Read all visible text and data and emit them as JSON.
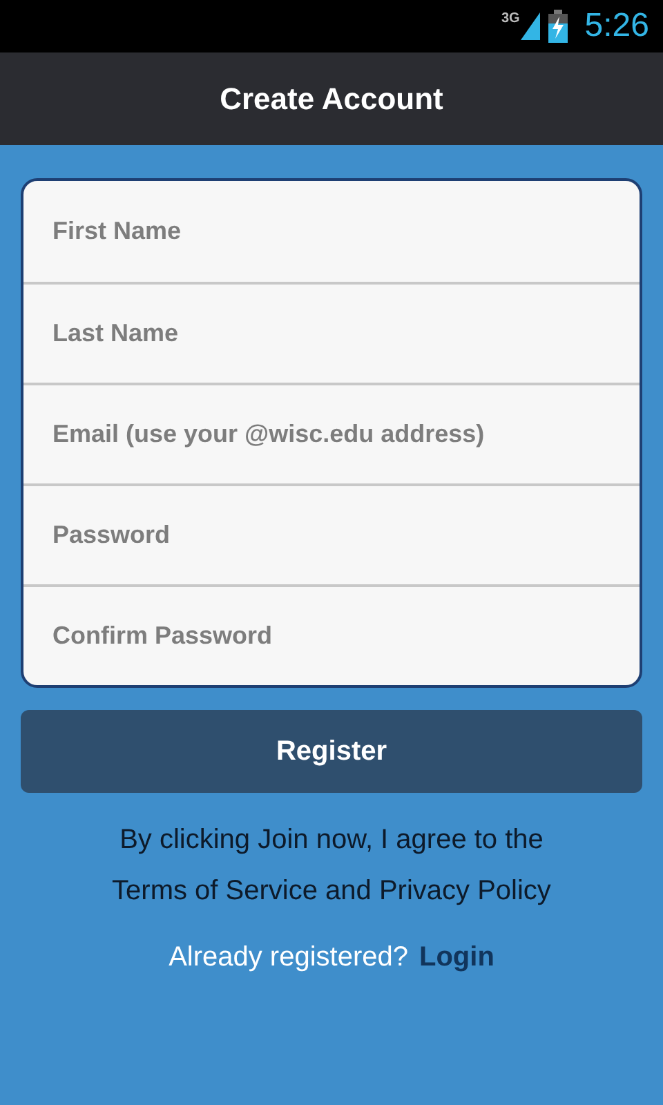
{
  "status_bar": {
    "network": "3G",
    "time": "5:26"
  },
  "header": {
    "title": "Create Account"
  },
  "fields": [
    {
      "placeholder": "First Name"
    },
    {
      "placeholder": "Last Name"
    },
    {
      "placeholder": "Email (use your @wisc.edu address)"
    },
    {
      "placeholder": "Password"
    },
    {
      "placeholder": "Confirm Password"
    }
  ],
  "register_button": "Register",
  "terms_text": "By clicking Join now, I agree to the Terms of Service and Privacy Policy",
  "login_prompt": {
    "text": "Already registered?",
    "link": "Login"
  }
}
